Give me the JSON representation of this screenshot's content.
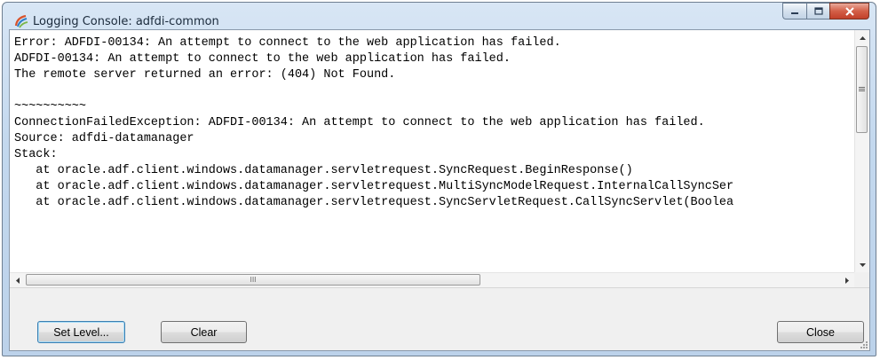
{
  "window": {
    "title": "Logging Console: adfdi-common",
    "icon": "logging-console-icon",
    "caption_buttons": [
      "minimize-icon",
      "maximize-icon",
      "close-icon"
    ]
  },
  "log": {
    "lines": [
      "Error: ADFDI-00134: An attempt to connect to the web application has failed.",
      "ADFDI-00134: An attempt to connect to the web application has failed.",
      "The remote server returned an error: (404) Not Found.",
      "",
      "~~~~~~~~~~",
      "ConnectionFailedException: ADFDI-00134: An attempt to connect to the web application has failed.",
      "Source: adfdi-datamanager",
      "Stack:",
      "   at oracle.adf.client.windows.datamanager.servletrequest.SyncRequest.BeginResponse()",
      "   at oracle.adf.client.windows.datamanager.servletrequest.MultiSyncModelRequest.InternalCallSyncSer",
      "   at oracle.adf.client.windows.datamanager.servletrequest.SyncServletRequest.CallSyncServlet(Boolea"
    ]
  },
  "scrollbars": {
    "vertical_position": 0,
    "horizontal_position": 0,
    "horizontal_thumb_glyph": "III"
  },
  "buttons": {
    "set_level": "Set Level...",
    "clear": "Clear",
    "close": "Close"
  },
  "colors": {
    "title_bar": "#c3d8ee",
    "close_button": "#c2402a",
    "dialog_background": "#f0f0f0",
    "default_button_border": "#3c7fb1"
  }
}
